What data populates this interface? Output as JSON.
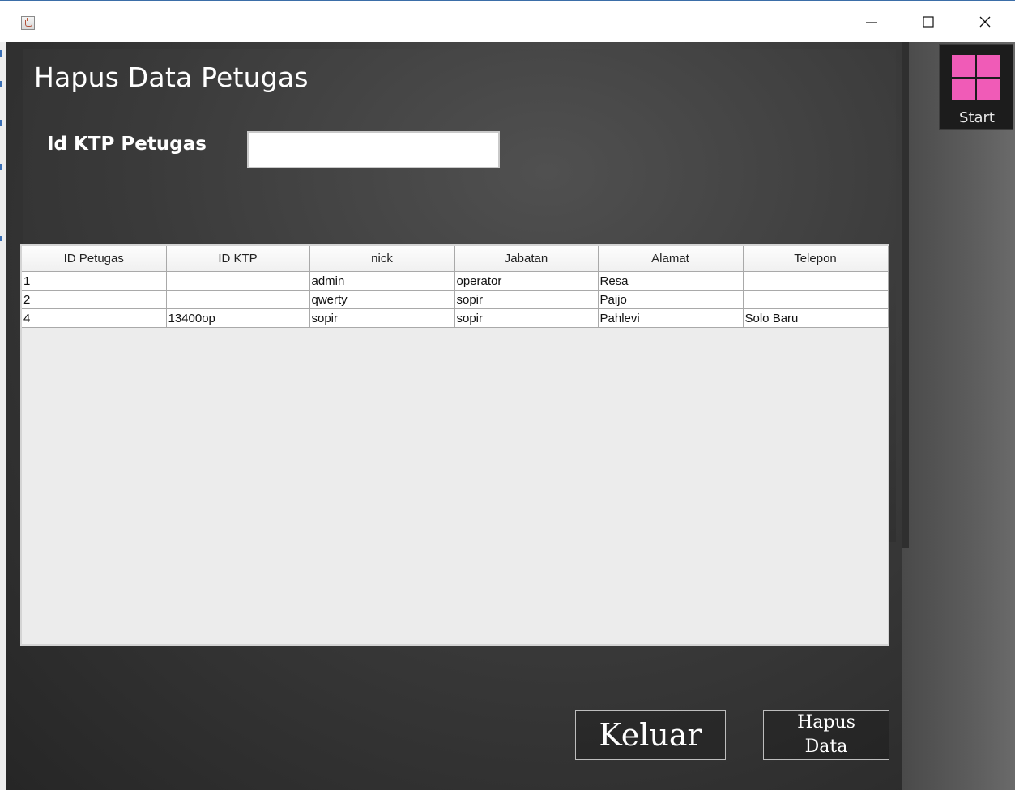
{
  "window": {
    "minimize_label": "—",
    "maximize_label": "☐",
    "close_label": "✕"
  },
  "form": {
    "title": "Hapus Data Petugas",
    "ktp_label": "Id KTP Petugas",
    "ktp_value": ""
  },
  "table": {
    "headers": [
      "ID Petugas",
      "ID KTP",
      "nick",
      "Jabatan",
      "Alamat",
      "Telepon"
    ],
    "rows": [
      [
        "1",
        "",
        "admin",
        "operator",
        "Resa",
        ""
      ],
      [
        "2",
        "",
        "qwerty",
        "sopir",
        "Paijo",
        ""
      ],
      [
        "4",
        "13400op",
        "sopir",
        "sopir",
        "Pahlevi",
        "Solo Baru"
      ]
    ]
  },
  "buttons": {
    "keluar": "Keluar",
    "hapus_line1": "Hapus",
    "hapus_line2": "Data"
  },
  "sidebar": {
    "start_label": "Start"
  },
  "colors": {
    "start_logo": "#f05bb7",
    "panel_dark": "#2a2a2a"
  }
}
